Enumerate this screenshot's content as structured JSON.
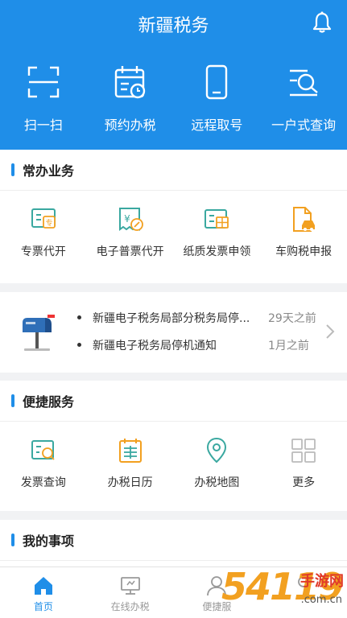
{
  "header": {
    "title": "新疆税务"
  },
  "quick_actions": [
    {
      "label": "扫一扫",
      "icon": "scan-icon"
    },
    {
      "label": "预约办税",
      "icon": "calendar-clock-icon"
    },
    {
      "label": "远程取号",
      "icon": "phone-icon"
    },
    {
      "label": "一户式查询",
      "icon": "search-doc-icon"
    }
  ],
  "common": {
    "title": "常办业务",
    "items": [
      {
        "label": "专票代开",
        "icon": "special-invoice-icon"
      },
      {
        "label": "电子普票代开",
        "icon": "e-invoice-icon"
      },
      {
        "label": "纸质发票申领",
        "icon": "paper-invoice-icon"
      },
      {
        "label": "车购税申报",
        "icon": "car-tax-icon"
      }
    ]
  },
  "notices": [
    {
      "text": "新疆电子税务局部分税务局停...",
      "time": "29天之前"
    },
    {
      "text": "新疆电子税务局停机通知",
      "time": "1月之前"
    }
  ],
  "convenient": {
    "title": "便捷服务",
    "items": [
      {
        "label": "发票查询",
        "icon": "invoice-search-icon"
      },
      {
        "label": "办税日历",
        "icon": "tax-calendar-icon"
      },
      {
        "label": "办税地图",
        "icon": "map-pin-icon"
      },
      {
        "label": "更多",
        "icon": "more-grid-icon"
      }
    ]
  },
  "my_items": {
    "title": "我的事项"
  },
  "bottom_nav": [
    {
      "label": "首页",
      "active": true
    },
    {
      "label": "在线办税",
      "active": false
    },
    {
      "label": "便捷服",
      "active": false
    },
    {
      "label": "",
      "active": false
    }
  ],
  "watermark": {
    "logo": "54119",
    "site": "手游网",
    "url": ".com.cn"
  },
  "colors": {
    "primary": "#1f8ee8",
    "accent_orange": "#f2a020",
    "icon_teal": "#3aa8a0"
  }
}
